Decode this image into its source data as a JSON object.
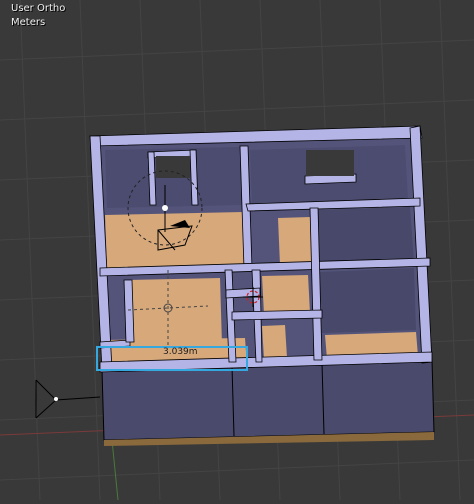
{
  "viewport": {
    "view_name": "User Ortho",
    "units": "Meters"
  },
  "measurement": {
    "label": "3.039m"
  },
  "colors": {
    "background": "#393939",
    "wall_top": "#b4b4e6",
    "wall_face": "#4e4e6e",
    "floor": "#d6a87a",
    "selection_box": "#36a8e0",
    "grid_x_axis": "#7a3a3a",
    "grid_y_axis": "#4a7a3a"
  },
  "icons": [
    "camera-icon",
    "lamp-icon",
    "3d-cursor-icon",
    "empty-icon"
  ]
}
